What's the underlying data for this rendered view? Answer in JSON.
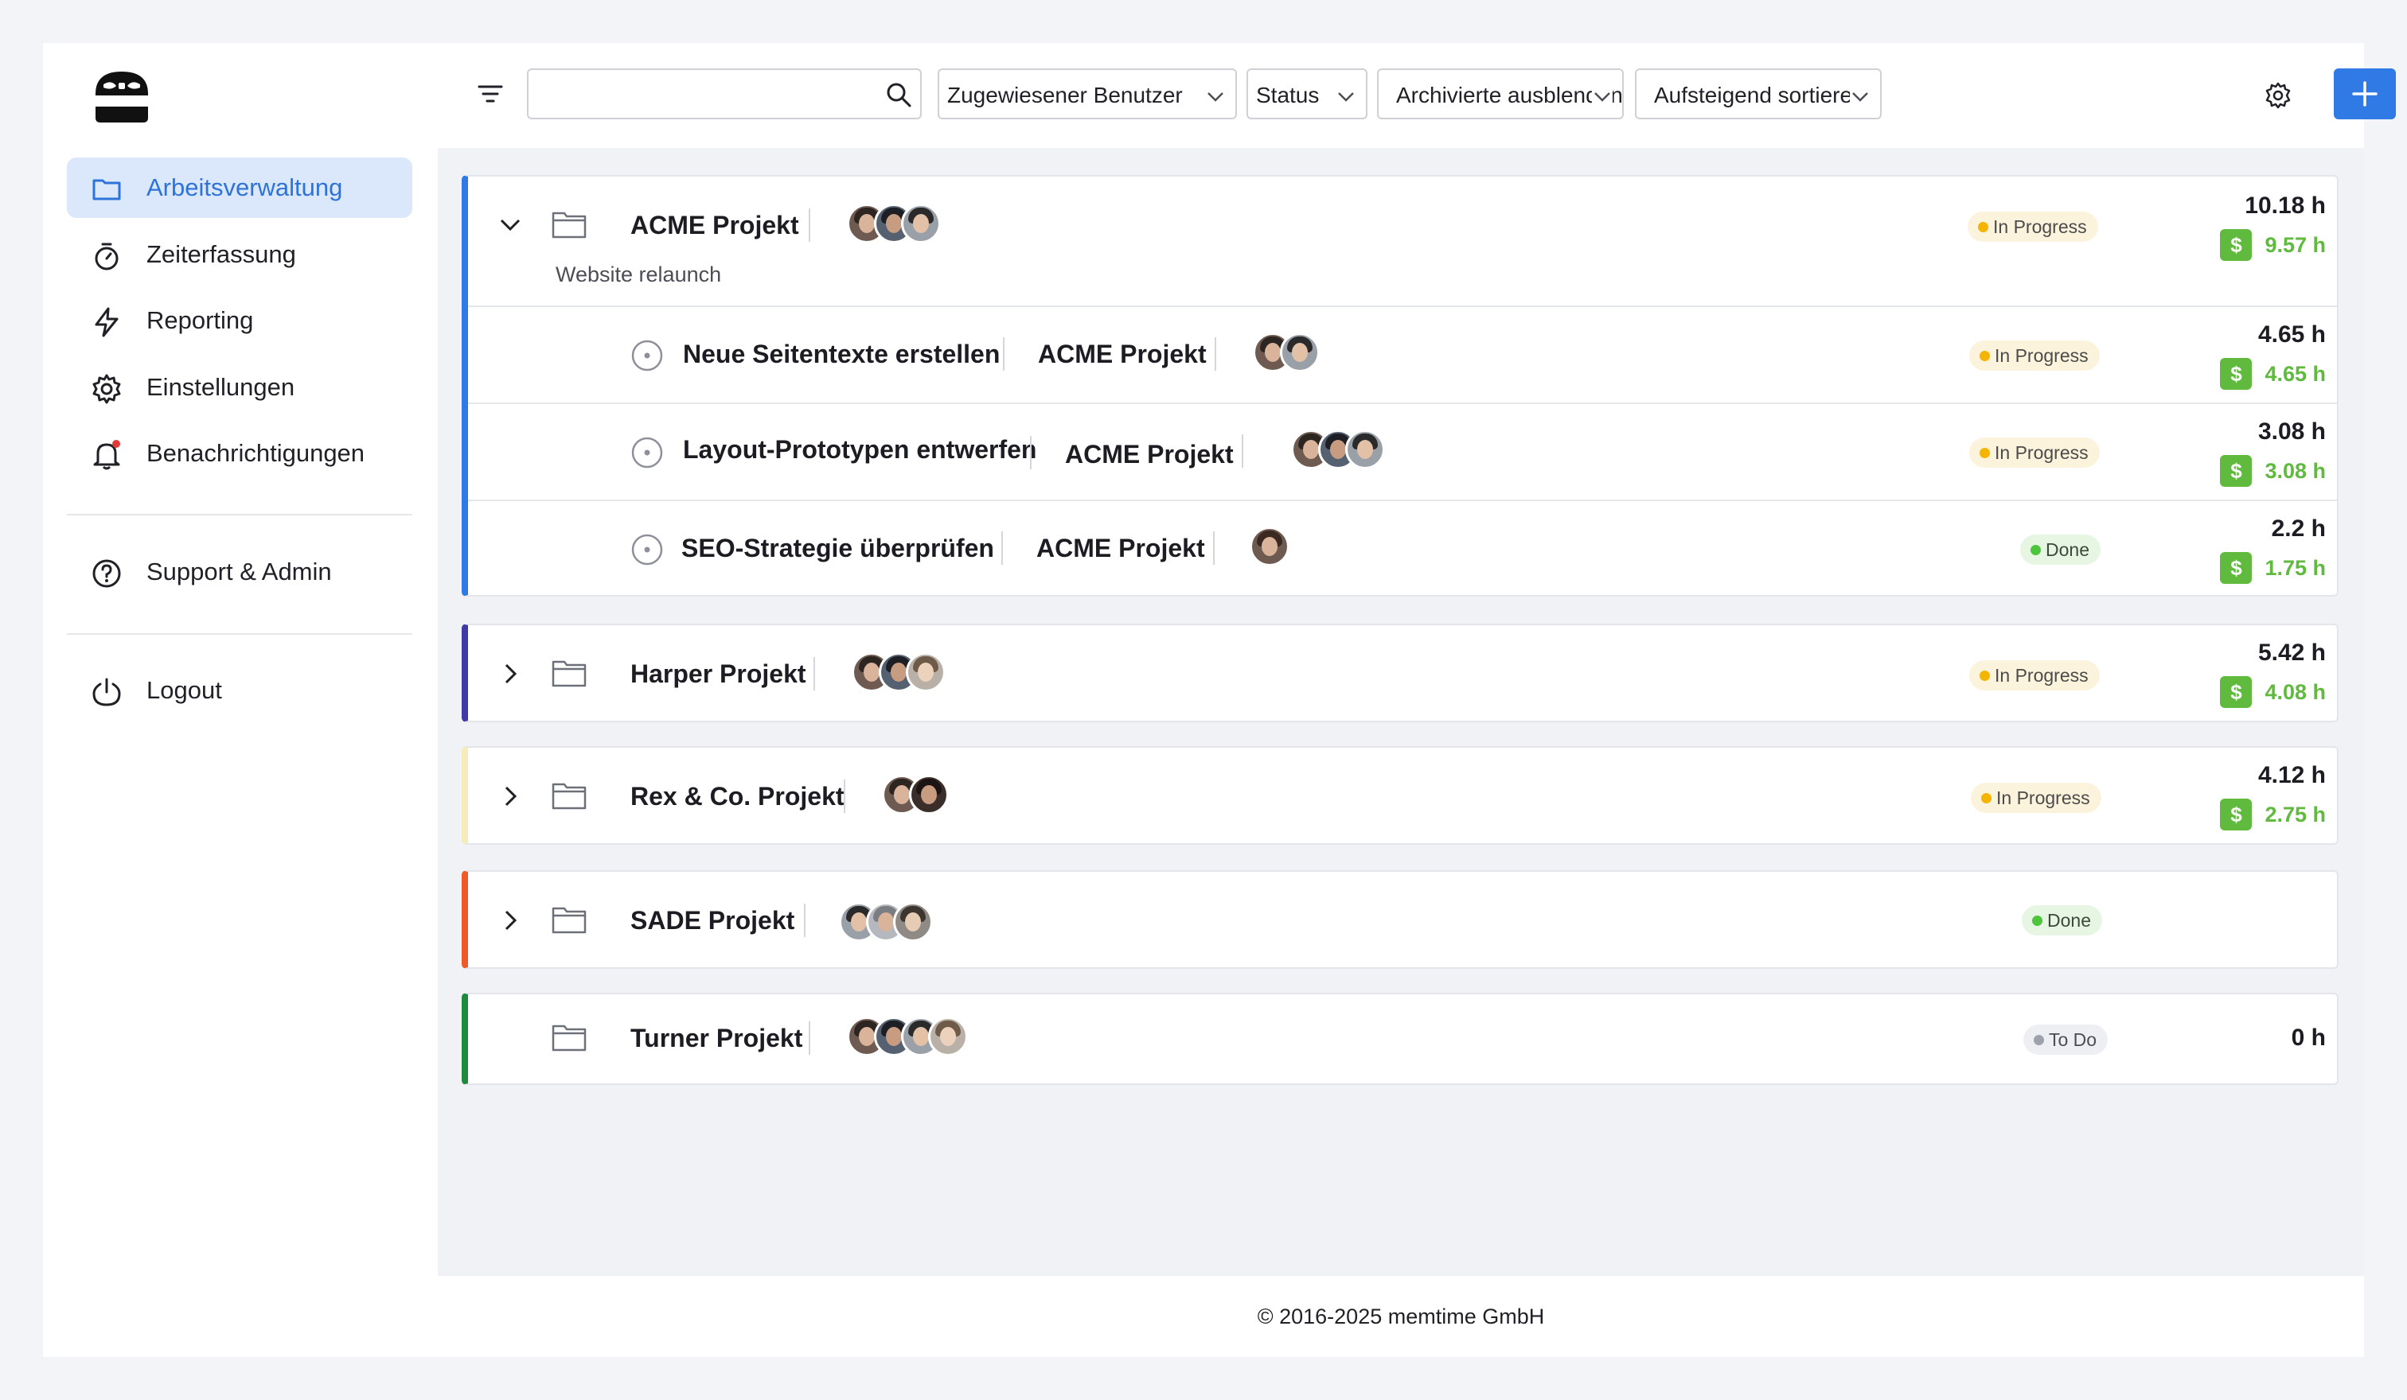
{
  "sidebar": {
    "items": [
      {
        "label": "Arbeitsverwaltung",
        "icon": "folder-icon",
        "active": true
      },
      {
        "label": "Zeiterfassung",
        "icon": "stopwatch-icon"
      },
      {
        "label": "Reporting",
        "icon": "lightning-icon"
      },
      {
        "label": "Einstellungen",
        "icon": "gear-icon"
      },
      {
        "label": "Benachrichtigungen",
        "icon": "bell-icon",
        "has_unread": true
      }
    ],
    "support": {
      "label": "Support & Admin",
      "icon": "help-circle-icon"
    },
    "logout": {
      "label": "Logout",
      "icon": "power-icon"
    }
  },
  "toolbar": {
    "search": {
      "value": "",
      "placeholder": ""
    },
    "assigned_user_filter": "Zugewiesener Benutzer",
    "status_filter": "Status",
    "archived_filter": "Archivierte ausblenden",
    "sort_order": "Aufsteigend sortieren",
    "accent_color": "#2f7ae5"
  },
  "projects": [
    {
      "name": "ACME Projekt",
      "subtitle": "Website relaunch",
      "expanded": true,
      "color": "#2f7ae5",
      "status": "In Progress",
      "hours": "10.18 h",
      "billable": "9.57 h",
      "tasks": [
        {
          "name": "Neue Seitentexte erstellen",
          "project": "ACME Projekt",
          "status": "In Progress",
          "hours": "4.65 h",
          "billable": "4.65 h"
        },
        {
          "name": "Layout-Prototypen entwerfen",
          "project": "ACME Projekt",
          "status": "In Progress",
          "hours": "3.08 h",
          "billable": "3.08 h"
        },
        {
          "name": "SEO-Strategie überprüfen",
          "project": "ACME Projekt",
          "status": "Done",
          "hours": "2.2 h",
          "billable": "1.75 h"
        }
      ]
    },
    {
      "name": "Harper Projekt",
      "color": "#3e3aa6",
      "status": "In Progress",
      "hours": "5.42 h",
      "billable": "4.08 h"
    },
    {
      "name": "Rex & Co. Projekt",
      "color": "#f6ecb9",
      "status": "In Progress",
      "hours": "4.12 h",
      "billable": "2.75 h"
    },
    {
      "name": "SADE Projekt",
      "color": "#f05a28",
      "status": "Done"
    },
    {
      "name": "Turner Projekt",
      "color": "#1f8a3c",
      "status": "To Do",
      "hours": "0 h"
    }
  ],
  "footer": "© 2016-2025 memtime GmbH"
}
